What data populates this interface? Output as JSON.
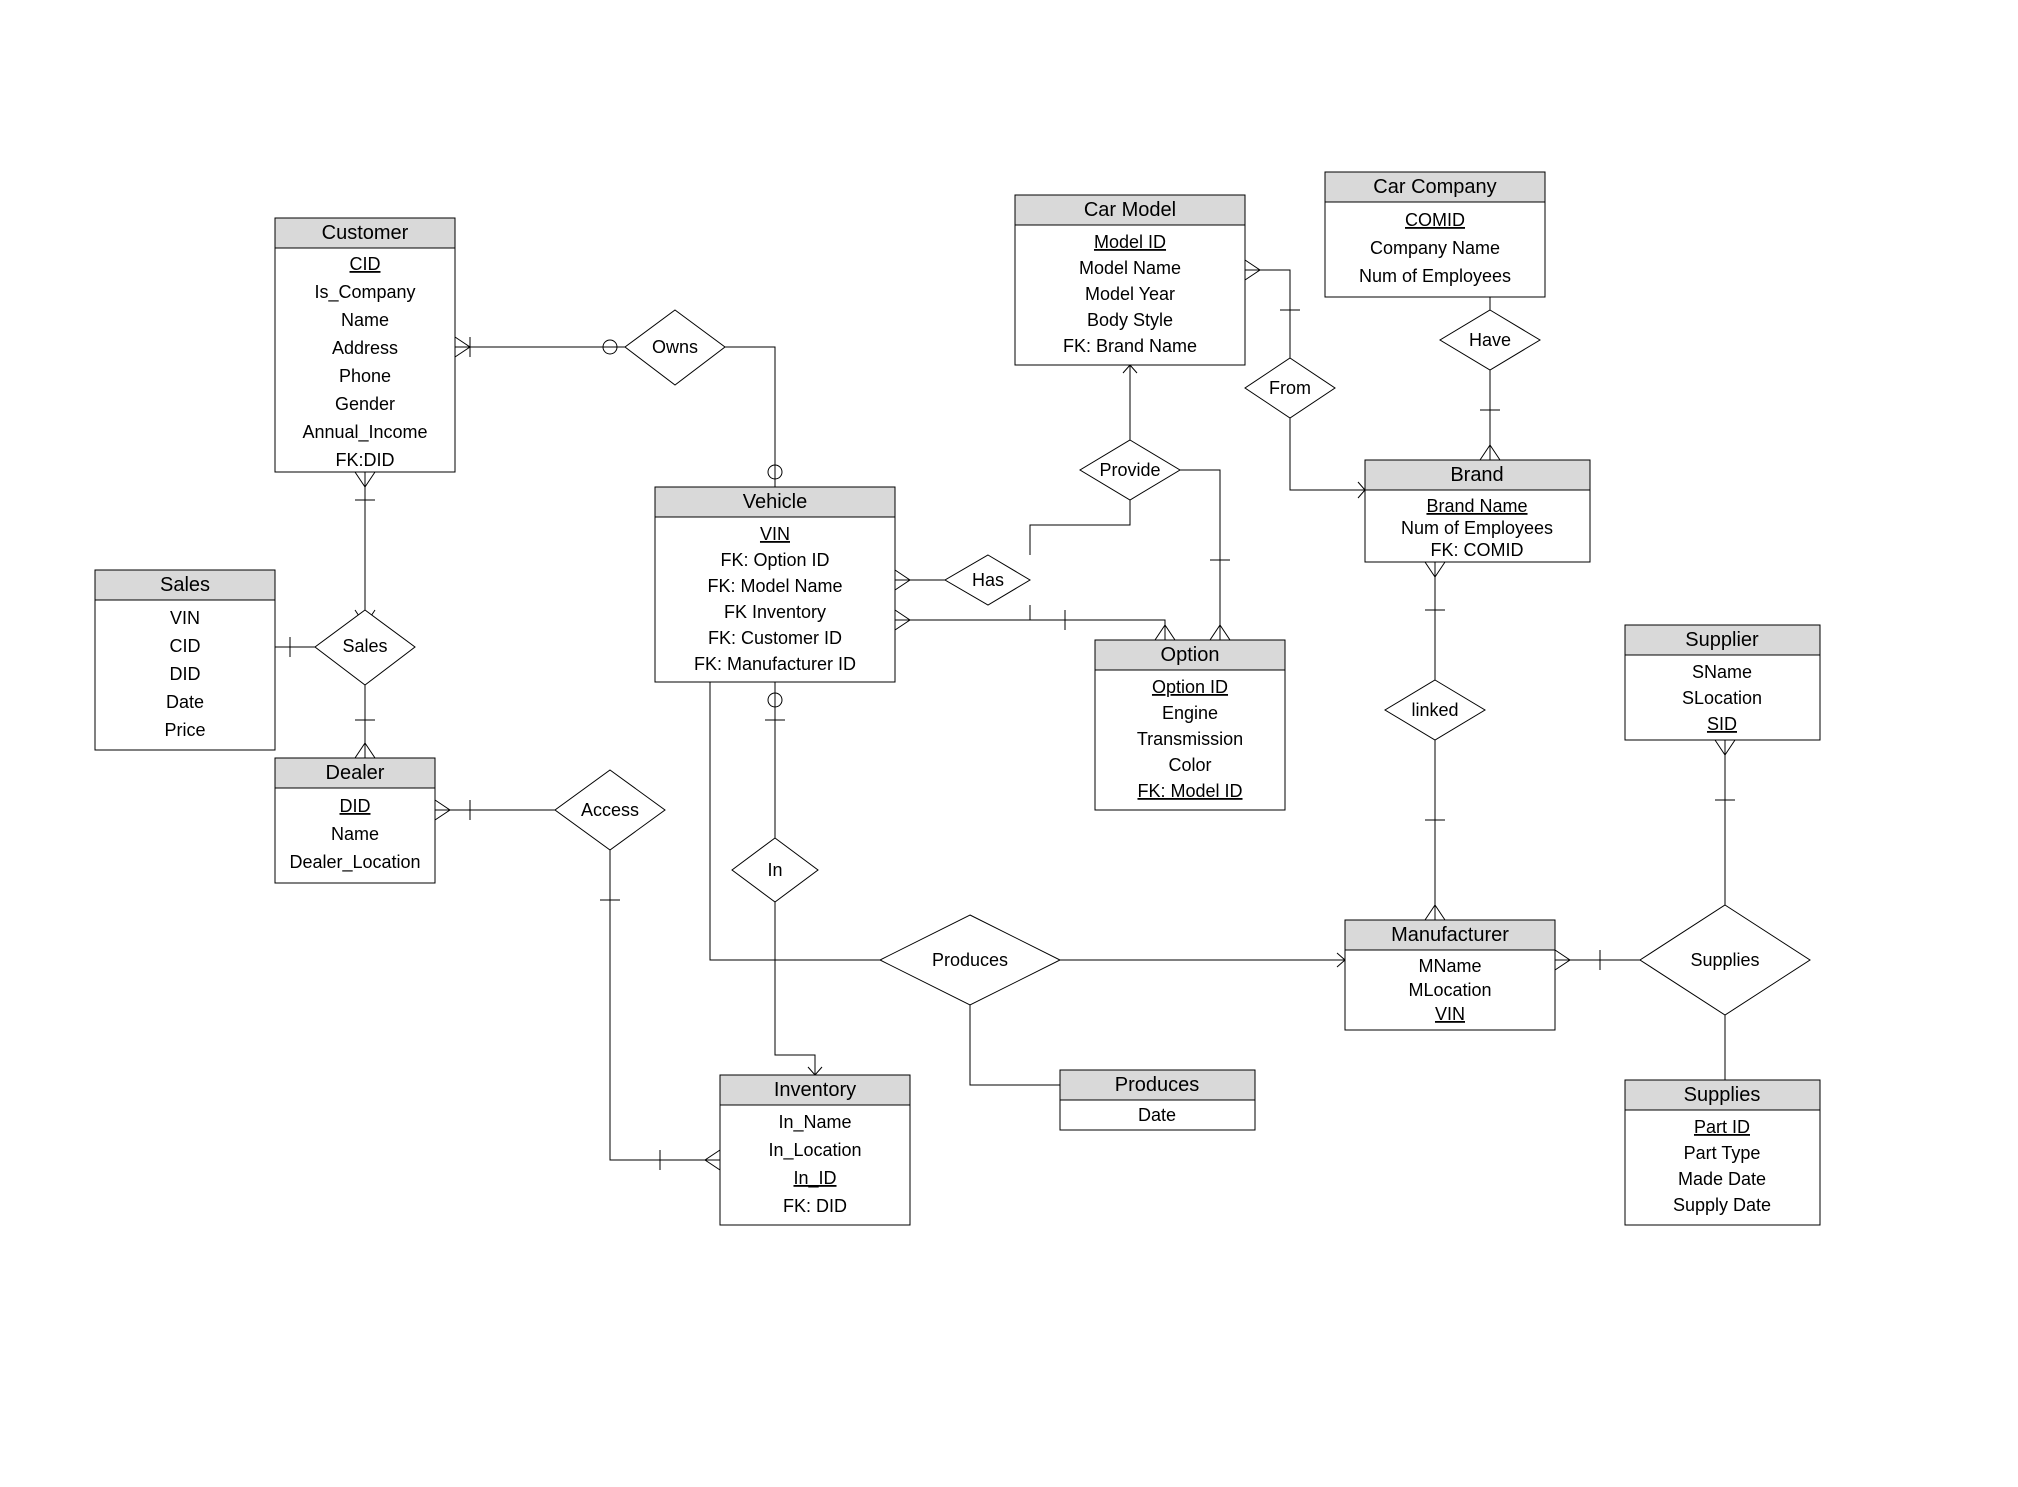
{
  "entities": {
    "customer": {
      "title": "Customer",
      "attrs": [
        "CID",
        "Is_Company",
        "Name",
        "Address",
        "Phone",
        "Gender",
        "Annual_Income",
        "FK:DID"
      ],
      "pk": [
        0
      ]
    },
    "sales": {
      "title": "Sales",
      "attrs": [
        "VIN",
        "CID",
        "DID",
        "Date",
        "Price"
      ],
      "pk": []
    },
    "dealer": {
      "title": "Dealer",
      "attrs": [
        "DID",
        "Name",
        "Dealer_Location"
      ],
      "pk": [
        0
      ]
    },
    "vehicle": {
      "title": "Vehicle",
      "attrs": [
        "VIN",
        "FK: Option ID",
        "FK: Model Name",
        "FK Inventory",
        "FK: Customer ID",
        "FK: Manufacturer ID"
      ],
      "pk": [
        0
      ]
    },
    "inventory": {
      "title": "Inventory",
      "attrs": [
        "In_Name",
        "In_Location",
        "In_ID",
        "FK: DID"
      ],
      "pk": [
        2
      ]
    },
    "carModel": {
      "title": "Car Model",
      "attrs": [
        "Model ID",
        "Model Name",
        "Model Year",
        "Body Style",
        "FK: Brand Name"
      ],
      "pk": [
        0
      ]
    },
    "option": {
      "title": "Option",
      "attrs": [
        "Option ID",
        "Engine",
        "Transmission",
        "Color",
        "FK: Model ID"
      ],
      "pk": [
        0,
        4
      ]
    },
    "carCompany": {
      "title": "Car Company",
      "attrs": [
        "COMID",
        "Company Name",
        "Num of Employees"
      ],
      "pk": [
        0
      ]
    },
    "brand": {
      "title": "Brand",
      "attrs": [
        "Brand Name",
        "Num of Employees",
        "FK: COMID"
      ],
      "pk": [
        0
      ]
    },
    "manufacturer": {
      "title": "Manufacturer",
      "attrs": [
        "MName",
        "MLocation",
        "VIN"
      ],
      "pk": [
        2
      ]
    },
    "supplier": {
      "title": "Supplier",
      "attrs": [
        "SName",
        "SLocation",
        "SID"
      ],
      "pk": [
        2
      ]
    },
    "supplies": {
      "title": "Supplies",
      "attrs": [
        "Part ID",
        "Part Type",
        "Made Date",
        "Supply Date"
      ],
      "pk": [
        0
      ]
    },
    "producesTbl": {
      "title": "Produces",
      "attrs": [
        "Date"
      ],
      "pk": []
    }
  },
  "relationships": {
    "owns": "Owns",
    "salesRel": "Sales",
    "access": "Access",
    "in": "In",
    "has": "Has",
    "provide": "Provide",
    "producesRel": "Produces",
    "from": "From",
    "have": "Have",
    "linked": "linked",
    "suppliesRel": "Supplies"
  }
}
